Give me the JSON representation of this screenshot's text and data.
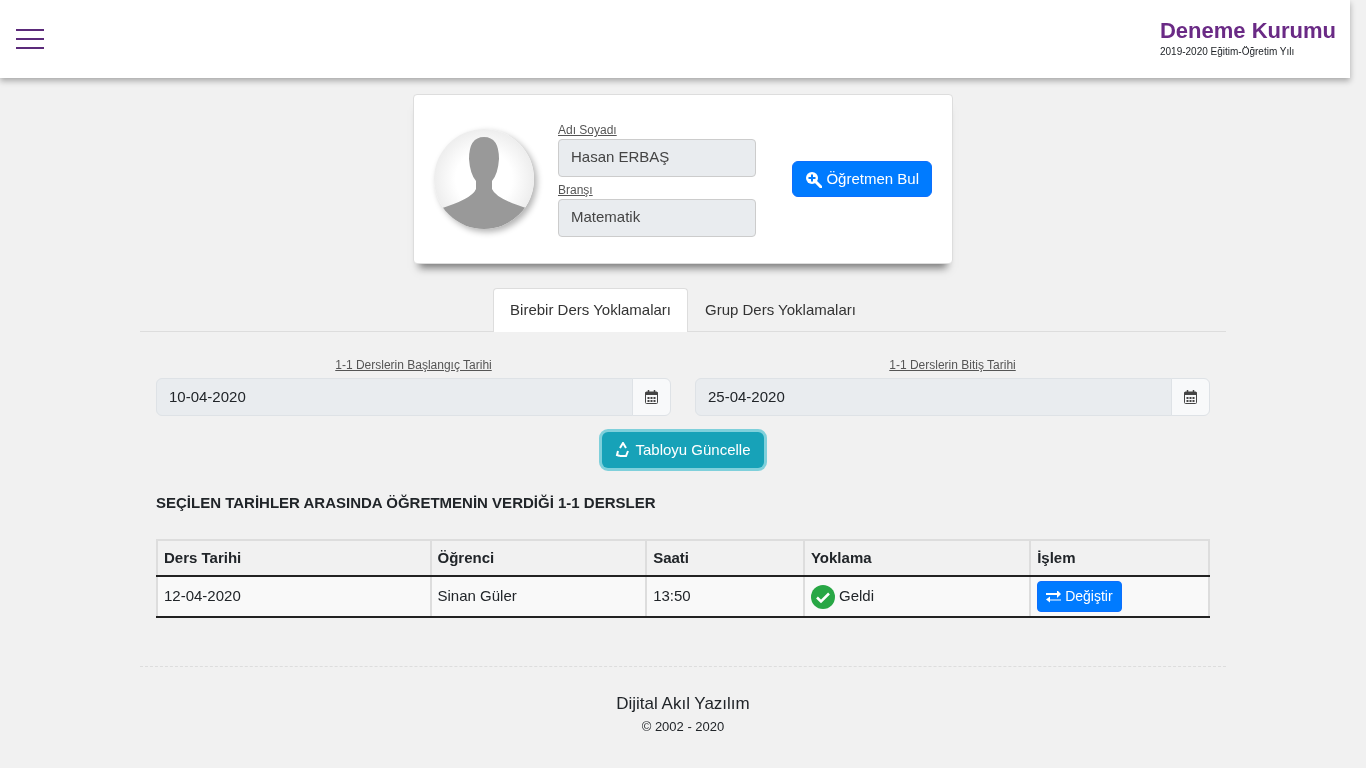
{
  "header": {
    "title": "Deneme Kurumu",
    "subtitle": "2019-2020 Eğitim-Öğretim Yılı"
  },
  "teacher": {
    "name_label": "Adı Soyadı",
    "name": "Hasan ERBAŞ",
    "branch_label": "Branşı",
    "branch": "Matematik",
    "find_button": "Öğretmen Bul"
  },
  "tabs": [
    {
      "label": "Birebir Ders Yoklamaları",
      "selected": true
    },
    {
      "label": "Grup Ders Yoklamaları",
      "selected": false
    }
  ],
  "dates": [
    {
      "label": "1-1 Derslerin Başlangıç Tarihi",
      "value": "10-04-2020"
    },
    {
      "label": "1-1 Derslerin Bitiş Tarihi",
      "value": "25-04-2020"
    }
  ],
  "update_button": "Tabloyu Güncelle",
  "section_title": "SEÇİLEN TARİHLER ARASINDA ÖĞRETMENİN VERDİĞİ 1-1 DERSLER",
  "table": {
    "columns": [
      "Ders Tarihi",
      "Öğrenci",
      "Saati",
      "Yoklama",
      "İşlem"
    ],
    "rows": [
      {
        "date": "12-04-2020",
        "student": "Sinan Güler",
        "time": "13:50",
        "attendance": {
          "kind": "present",
          "text": "Geldi"
        },
        "action": "Değiştir"
      }
    ]
  },
  "footer": {
    "company": "Dijital Akıl Yazılım",
    "copyright": "© 2002 - 2020"
  }
}
